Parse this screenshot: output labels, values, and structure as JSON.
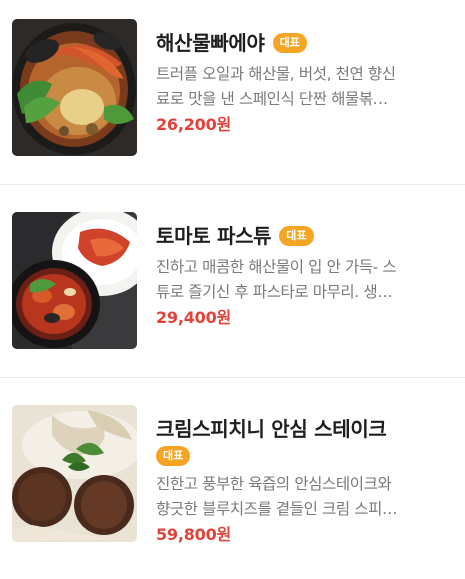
{
  "menu": {
    "items": [
      {
        "name": "해산물빠에야",
        "badge": "대표",
        "desc_line1": "트러플 오일과 해산물, 버섯, 천연 향신",
        "desc_line2": "료로 맛을 낸 스페인식 단짠 해물볶…",
        "price": "26,200원",
        "image": "seafood-paella-photo"
      },
      {
        "name": "토마토 파스튜",
        "badge": "대표",
        "desc_line1": "진하고 매콤한 해산물이 입 안 가득- 스",
        "desc_line2": "튜로 즐기신 후 파스타로 마무리. 생…",
        "price": "29,400원",
        "image": "tomato-pastew-photo"
      },
      {
        "name": "크림스피치니 안심 스테이크",
        "badge": "대표",
        "desc_line1": "진한고 풍부한 육즙의 안심스테이크와",
        "desc_line2": "향긋한 블루치즈를 곁들인 크림 스피…",
        "price": "59,800원",
        "image": "cream-spicchini-steak-photo"
      }
    ]
  },
  "colors": {
    "badge": "#f5a524",
    "price": "#e2423a",
    "description": "#7a7a7a",
    "divider": "#ececec"
  }
}
